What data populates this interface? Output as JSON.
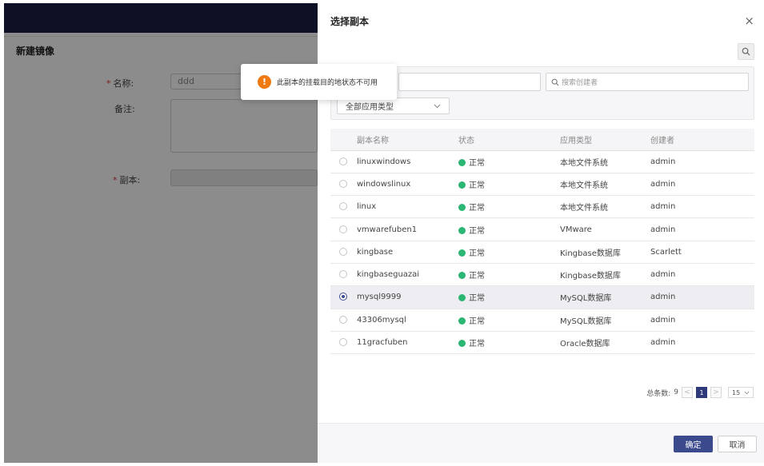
{
  "background_form": {
    "title": "新建镜像",
    "name_label": "名称:",
    "name_value": "ddd",
    "remark_label": "备注:",
    "replica_label": "副本:",
    "required_mark": "*"
  },
  "toast": {
    "icon": "warning-icon",
    "glyph": "!",
    "message": "此副本的挂载目的地状态不可用"
  },
  "drawer": {
    "title": "选择副本",
    "close_glyph": "×",
    "search_creator_placeholder": "搜索创建者",
    "app_type_select": "全部应用类型",
    "columns": [
      "副本名称",
      "状态",
      "应用类型",
      "创建者"
    ],
    "rows": [
      {
        "name": "linuxwindows",
        "status": "正常",
        "app_type": "本地文件系统",
        "creator": "admin",
        "selected": false
      },
      {
        "name": "windowslinux",
        "status": "正常",
        "app_type": "本地文件系统",
        "creator": "admin",
        "selected": false
      },
      {
        "name": "linux",
        "status": "正常",
        "app_type": "本地文件系统",
        "creator": "admin",
        "selected": false
      },
      {
        "name": "vmwarefuben1",
        "status": "正常",
        "app_type": "VMware",
        "creator": "admin",
        "selected": false
      },
      {
        "name": "kingbase",
        "status": "正常",
        "app_type": "Kingbase数据库",
        "creator": "Scarlett",
        "selected": false
      },
      {
        "name": "kingbaseguazai",
        "status": "正常",
        "app_type": "Kingbase数据库",
        "creator": "admin",
        "selected": false
      },
      {
        "name": "mysql9999",
        "status": "正常",
        "app_type": "MySQL数据库",
        "creator": "admin",
        "selected": true
      },
      {
        "name": "43306mysql",
        "status": "正常",
        "app_type": "MySQL数据库",
        "creator": "admin",
        "selected": false
      },
      {
        "name": "11gracfuben",
        "status": "正常",
        "app_type": "Oracle数据库",
        "creator": "admin",
        "selected": false
      }
    ],
    "status_color": "#2bb673",
    "pagination": {
      "total_label": "总条数:",
      "total": "9",
      "prev": "<",
      "current_page": "1",
      "next": ">",
      "page_size": "15"
    },
    "ok_label": "确定",
    "cancel_label": "取消",
    "accent_color": "#3b4a8c"
  }
}
